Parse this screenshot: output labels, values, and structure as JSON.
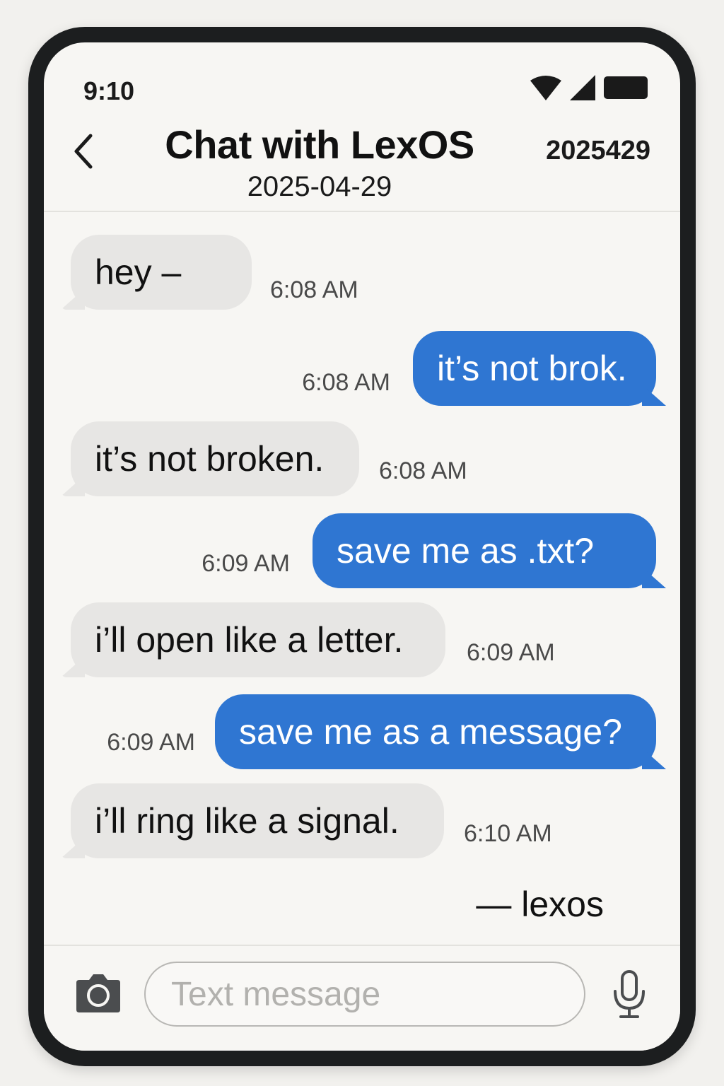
{
  "status_bar": {
    "time": "9:10",
    "icons": [
      "wifi-icon",
      "cellular-signal-icon",
      "battery-icon"
    ]
  },
  "header": {
    "back_icon": "chevron-left-icon",
    "title": "Chat with LexOS",
    "date": "2025-04-29",
    "code": "2025429"
  },
  "messages": [
    {
      "direction": "incoming",
      "text": "hey –",
      "time": "6:08 AM"
    },
    {
      "direction": "outgoing",
      "text": "it’s not brok.",
      "time": "6:08 AM"
    },
    {
      "direction": "incoming",
      "text": "it’s not broken.",
      "time": "6:08 AM"
    },
    {
      "direction": "outgoing",
      "text": "save me as .txt?",
      "time": "6:09 AM"
    },
    {
      "direction": "incoming",
      "text": "i’ll open like a letter.",
      "time": "6:09 AM"
    },
    {
      "direction": "outgoing",
      "text": "save me as a message?",
      "time": "6:09 AM"
    },
    {
      "direction": "incoming",
      "text": "i’ll ring like a signal.",
      "time": "6:10 AM"
    }
  ],
  "signature": "— lexos",
  "composer": {
    "placeholder": "Text message",
    "value": "",
    "camera_icon": "camera-icon",
    "mic_icon": "microphone-icon"
  },
  "colors": {
    "outgoing_bubble": "#2f76d2",
    "incoming_bubble": "#e7e6e4",
    "frame": "#1c1e1f",
    "screen_background": "#f7f6f3"
  }
}
